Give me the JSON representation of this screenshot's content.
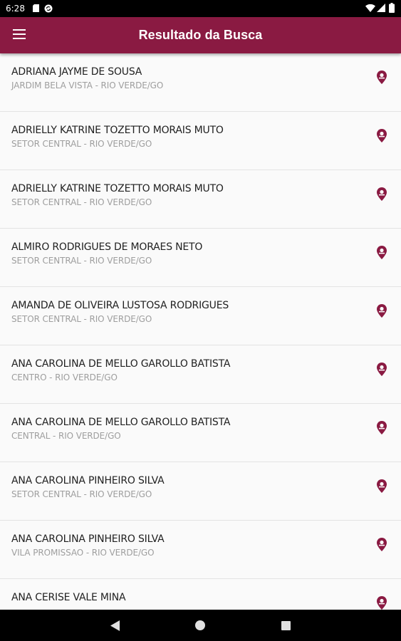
{
  "status_bar": {
    "time": "6:28"
  },
  "app_bar": {
    "title": "Resultado da Busca",
    "menu_icon": "hamburger-menu-icon"
  },
  "colors": {
    "primary": "#8a1a42",
    "text_primary": "#212121",
    "text_secondary": "#9e9e9e"
  },
  "results": [
    {
      "name": "ADRIANA JAYME DE SOUSA",
      "address": "JARDIM BELA VISTA - RIO VERDE/GO"
    },
    {
      "name": "ADRIELLY KATRINE TOZETTO MORAIS MUTO",
      "address": "SETOR CENTRAL - RIO VERDE/GO"
    },
    {
      "name": "ADRIELLY KATRINE TOZETTO MORAIS MUTO",
      "address": "SETOR CENTRAL - RIO VERDE/GO"
    },
    {
      "name": "ALMIRO RODRIGUES DE MORAES NETO",
      "address": "SETOR CENTRAL - RIO VERDE/GO"
    },
    {
      "name": "AMANDA DE OLIVEIRA LUSTOSA RODRIGUES",
      "address": "SETOR CENTRAL - RIO VERDE/GO"
    },
    {
      "name": "ANA CAROLINA DE MELLO GAROLLO BATISTA",
      "address": "CENTRO - RIO VERDE/GO"
    },
    {
      "name": "ANA CAROLINA DE MELLO GAROLLO BATISTA",
      "address": "CENTRAL - RIO VERDE/GO"
    },
    {
      "name": "ANA CAROLINA PINHEIRO SILVA",
      "address": "SETOR CENTRAL - RIO VERDE/GO"
    },
    {
      "name": "ANA CAROLINA PINHEIRO SILVA",
      "address": "VILA PROMISSAO - RIO VERDE/GO"
    },
    {
      "name": "ANA CERISE VALE MINA",
      "address": ""
    }
  ]
}
